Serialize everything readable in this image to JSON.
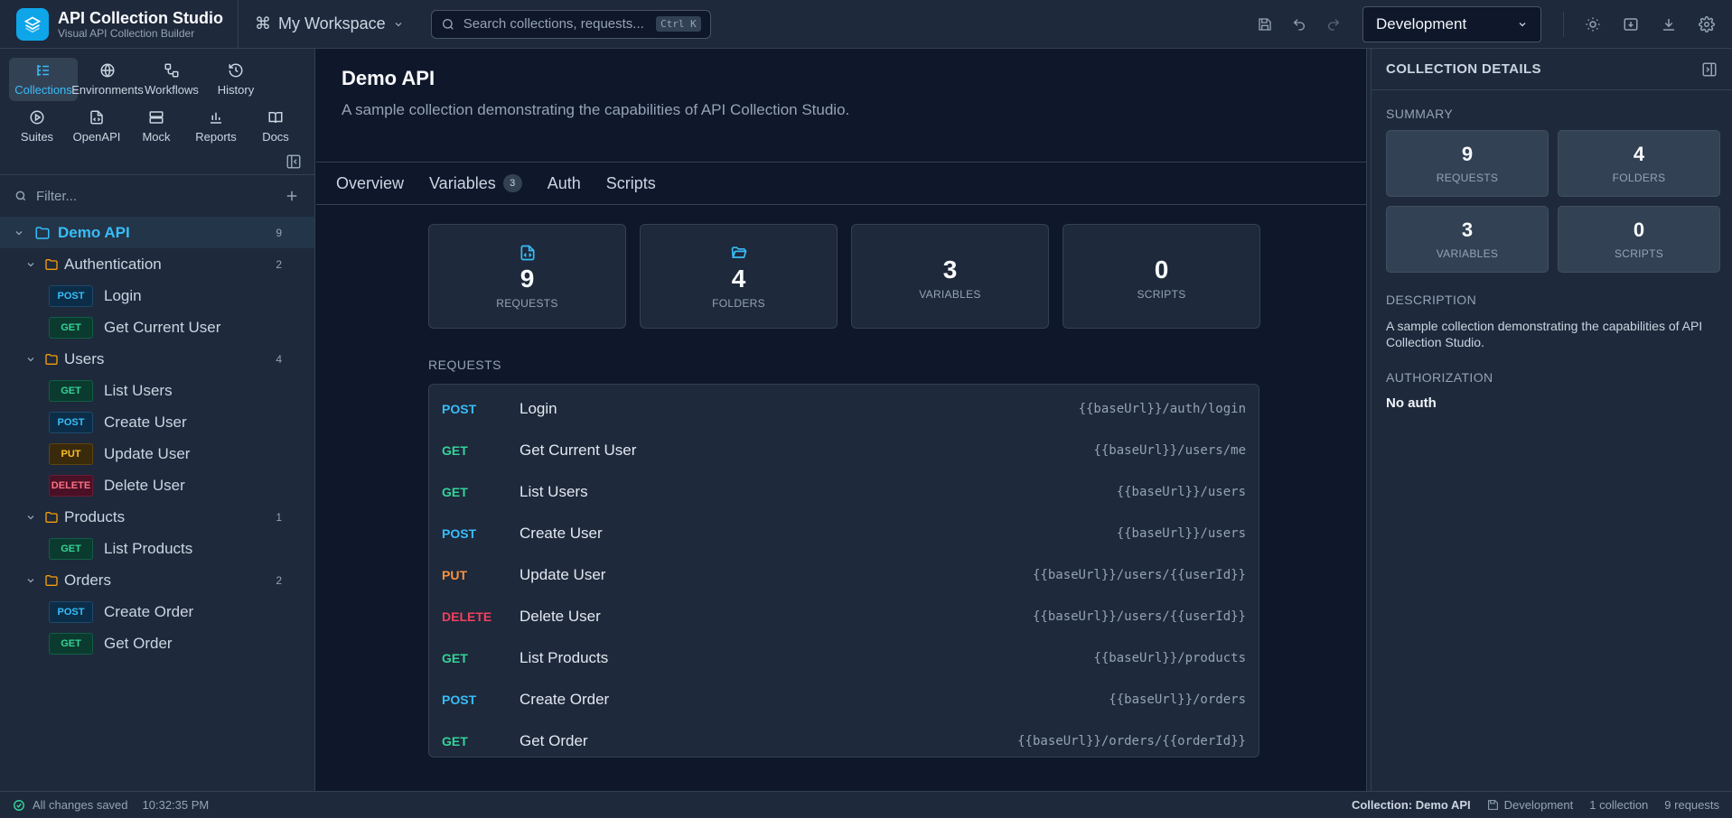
{
  "app": {
    "title": "API Collection Studio",
    "subtitle": "Visual API Collection Builder"
  },
  "workspace": {
    "label": "My Workspace"
  },
  "search": {
    "placeholder": "Search collections, requests...",
    "shortcut": "Ctrl K"
  },
  "environment": {
    "selected": "Development"
  },
  "nav": {
    "row1": [
      {
        "label": "Collections",
        "icon": "list-icon",
        "active": true
      },
      {
        "label": "Environments",
        "icon": "globe-icon"
      },
      {
        "label": "Workflows",
        "icon": "workflow-icon"
      },
      {
        "label": "History",
        "icon": "history-icon"
      }
    ],
    "row2": [
      {
        "label": "Suites",
        "icon": "play-icon"
      },
      {
        "label": "OpenAPI",
        "icon": "file-code-icon"
      },
      {
        "label": "Mock",
        "icon": "server-icon"
      },
      {
        "label": "Reports",
        "icon": "bar-chart-icon"
      },
      {
        "label": "Docs",
        "icon": "book-icon"
      }
    ]
  },
  "sidebar": {
    "filter_placeholder": "Filter...",
    "root": {
      "name": "Demo API",
      "count": "9"
    },
    "folders": [
      {
        "name": "Authentication",
        "count": "2",
        "requests": [
          {
            "method": "POST",
            "name": "Login"
          },
          {
            "method": "GET",
            "name": "Get Current User"
          }
        ]
      },
      {
        "name": "Users",
        "count": "4",
        "requests": [
          {
            "method": "GET",
            "name": "List Users"
          },
          {
            "method": "POST",
            "name": "Create User"
          },
          {
            "method": "PUT",
            "name": "Update User"
          },
          {
            "method": "DELETE",
            "name": "Delete User"
          }
        ]
      },
      {
        "name": "Products",
        "count": "1",
        "requests": [
          {
            "method": "GET",
            "name": "List Products"
          }
        ]
      },
      {
        "name": "Orders",
        "count": "2",
        "requests": [
          {
            "method": "POST",
            "name": "Create Order"
          },
          {
            "method": "GET",
            "name": "Get Order"
          }
        ]
      }
    ]
  },
  "main": {
    "title": "Demo API",
    "description": "A sample collection demonstrating the capabilities of API Collection Studio.",
    "tabs": [
      {
        "label": "Overview"
      },
      {
        "label": "Variables",
        "count": "3"
      },
      {
        "label": "Auth"
      },
      {
        "label": "Scripts"
      }
    ],
    "stats": [
      {
        "value": "9",
        "label": "REQUESTS",
        "icon": "file-code-icon"
      },
      {
        "value": "4",
        "label": "FOLDERS",
        "icon": "folder-open-icon"
      },
      {
        "value": "3",
        "label": "VARIABLES"
      },
      {
        "value": "0",
        "label": "SCRIPTS"
      }
    ],
    "requests_heading": "REQUESTS",
    "requests": [
      {
        "method": "POST",
        "name": "Login",
        "url": "{{baseUrl}}/auth/login"
      },
      {
        "method": "GET",
        "name": "Get Current User",
        "url": "{{baseUrl}}/users/me"
      },
      {
        "method": "GET",
        "name": "List Users",
        "url": "{{baseUrl}}/users"
      },
      {
        "method": "POST",
        "name": "Create User",
        "url": "{{baseUrl}}/users"
      },
      {
        "method": "PUT",
        "name": "Update User",
        "url": "{{baseUrl}}/users/{{userId}}"
      },
      {
        "method": "DELETE",
        "name": "Delete User",
        "url": "{{baseUrl}}/users/{{userId}}"
      },
      {
        "method": "GET",
        "name": "List Products",
        "url": "{{baseUrl}}/products"
      },
      {
        "method": "POST",
        "name": "Create Order",
        "url": "{{baseUrl}}/orders"
      },
      {
        "method": "GET",
        "name": "Get Order",
        "url": "{{baseUrl}}/orders/{{orderId}}"
      }
    ]
  },
  "details": {
    "title": "COLLECTION DETAILS",
    "summary_label": "SUMMARY",
    "summary": [
      {
        "value": "9",
        "label": "REQUESTS"
      },
      {
        "value": "4",
        "label": "FOLDERS"
      },
      {
        "value": "3",
        "label": "VARIABLES"
      },
      {
        "value": "0",
        "label": "SCRIPTS"
      }
    ],
    "description_label": "DESCRIPTION",
    "description": "A sample collection demonstrating the capabilities of API Collection Studio.",
    "authorization_label": "AUTHORIZATION",
    "authorization": "No auth"
  },
  "status": {
    "saved": "All changes saved",
    "time": "10:32:35 PM",
    "collection": "Collection: Demo API",
    "environment": "Development",
    "collections_count": "1 collection",
    "requests_count": "9 requests"
  },
  "colors": {
    "accent": "#38bdf8",
    "get": "#34d399",
    "post": "#38bdf8",
    "put": "#fb923c",
    "delete": "#f43f5e"
  }
}
